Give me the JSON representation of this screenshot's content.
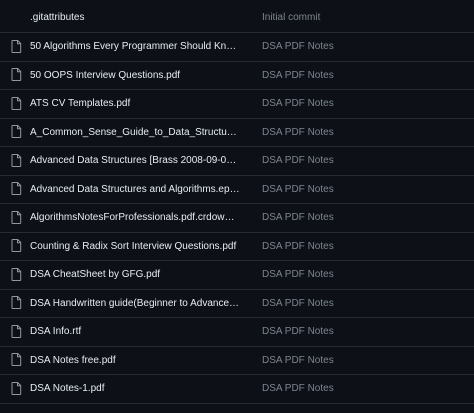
{
  "files": [
    {
      "name": ".gitattributes",
      "commit": "Initial commit"
    },
    {
      "name": "50 Algorithms Every Programmer Should Kno...",
      "commit": "DSA PDF Notes"
    },
    {
      "name": "50 OOPS Interview Questions.pdf",
      "commit": "DSA PDF Notes"
    },
    {
      "name": "ATS CV Templates.pdf",
      "commit": "DSA PDF Notes"
    },
    {
      "name": "A_Common_Sense_Guide_to_Data_Structures_...",
      "commit": "DSA PDF Notes"
    },
    {
      "name": "Advanced Data Structures [Brass 2008-09-08]....",
      "commit": "DSA PDF Notes"
    },
    {
      "name": "Advanced Data Structures and Algorithms.epub",
      "commit": "DSA PDF Notes"
    },
    {
      "name": "AlgorithmsNotesForProfessionals.pdf.crdownlo...",
      "commit": "DSA PDF Notes"
    },
    {
      "name": "Counting & Radix Sort Interview Questions.pdf",
      "commit": "DSA PDF Notes"
    },
    {
      "name": "DSA CheatSheet by GFG.pdf",
      "commit": "DSA PDF Notes"
    },
    {
      "name": "DSA Handwritten guide(Beginner to Advanced...",
      "commit": "DSA PDF Notes"
    },
    {
      "name": "DSA Info.rtf",
      "commit": "DSA PDF Notes"
    },
    {
      "name": "DSA Notes free.pdf",
      "commit": "DSA PDF Notes"
    },
    {
      "name": "DSA Notes-1.pdf",
      "commit": "DSA PDF Notes"
    }
  ],
  "icons": {
    "file": "file-icon"
  },
  "colors": {
    "background": "#0d1117",
    "text": "#e6edf3",
    "muted": "#7d8590",
    "border": "#262c36"
  }
}
